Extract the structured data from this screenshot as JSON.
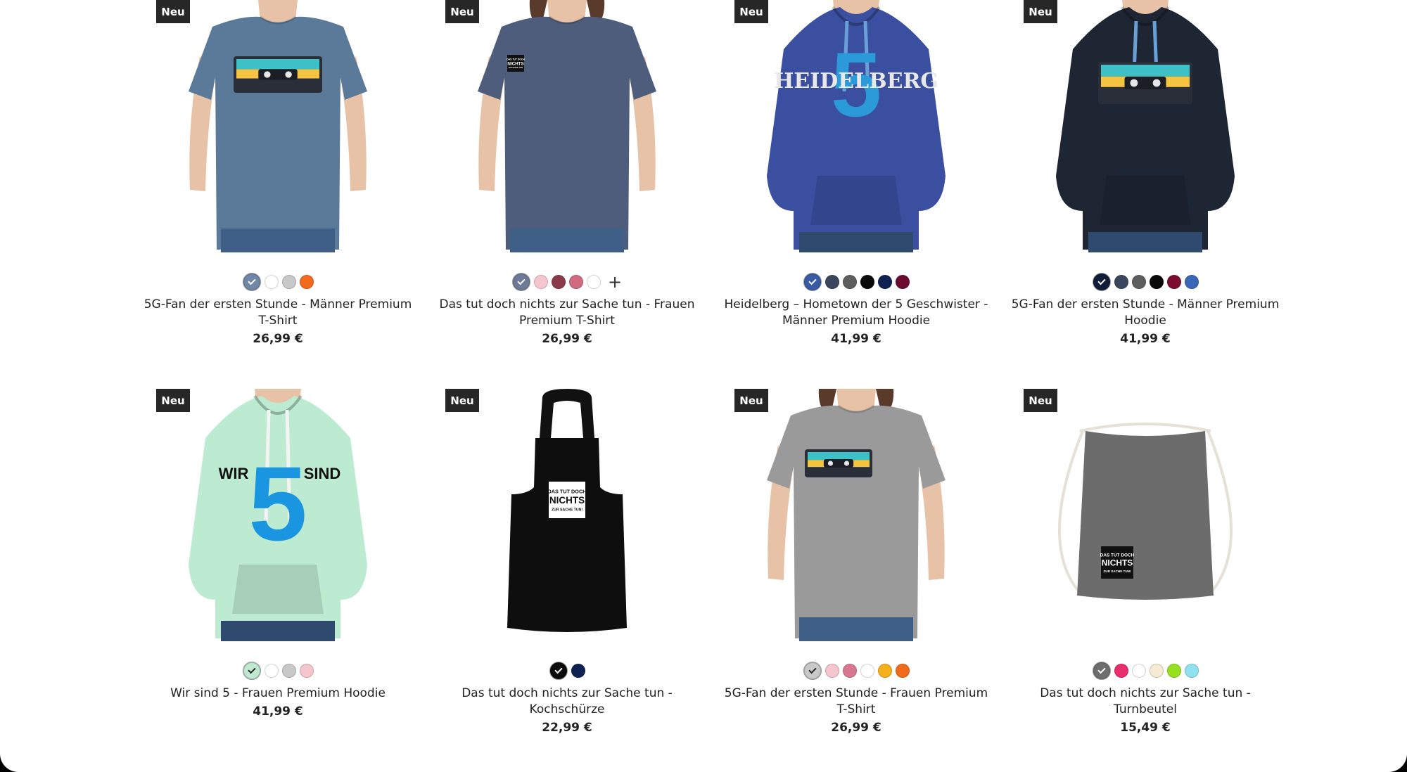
{
  "badge_label": "Neu",
  "products": [
    {
      "title": "5G-Fan der ersten Stunde - Männer Premium T-Shirt",
      "price": "26,99 €",
      "colors": [
        "#6f87a8",
        "#ffffff",
        "#c8c8c8",
        "#f26a1b"
      ],
      "selected": 0,
      "more": ""
    },
    {
      "title": "Das tut doch nichts zur Sache tun - Frauen Premium T-Shirt",
      "price": "26,99 €",
      "colors": [
        "#6f7a98",
        "#f6c6ce",
        "#8a3a48",
        "#d06a7e",
        "#ffffff"
      ],
      "selected": 0,
      "more": "+"
    },
    {
      "title": "Heidelberg – Hometown der 5 Geschwister - Männer Premium Hoodie",
      "price": "41,99 €",
      "colors": [
        "#3a5aa6",
        "#39465e",
        "#5e5e5e",
        "#0a0a0a",
        "#0e2150",
        "#6c0a2e"
      ],
      "selected": 0,
      "more": ""
    },
    {
      "title": "5G-Fan der ersten Stunde - Männer Premium Hoodie",
      "price": "41,99 €",
      "colors": [
        "#0f1d3a",
        "#39465e",
        "#5e5e5e",
        "#0a0a0a",
        "#7a0a30",
        "#3a66b8"
      ],
      "selected": 0,
      "more": ""
    },
    {
      "title": "Wir sind 5 - Frauen Premium Hoodie",
      "price": "41,99 €",
      "colors": [
        "#bfe9d1",
        "#ffffff",
        "#c8c8c8",
        "#f6c6ce"
      ],
      "selected": 0,
      "more": ""
    },
    {
      "title": "Das tut doch nichts zur Sache tun - Kochschürze",
      "price": "22,99 €",
      "colors": [
        "#0a0a0a",
        "#0e2150"
      ],
      "selected": 0,
      "more": ""
    },
    {
      "title": "5G-Fan der ersten Stunde - Frauen Premium T-Shirt",
      "price": "26,99 €",
      "colors": [
        "#c9c9c9",
        "#f6c6ce",
        "#d87890",
        "#ffffff",
        "#f5b01c",
        "#f26a1b"
      ],
      "selected": 0,
      "more": ""
    },
    {
      "title": "Das tut doch nichts zur Sache tun - Turnbeutel",
      "price": "15,49 €",
      "colors": [
        "#6e6e6e",
        "#ea2d6d",
        "#ffffff",
        "#f6ecd5",
        "#97e01f",
        "#8ee1ef"
      ],
      "selected": 0,
      "more": ""
    }
  ],
  "print_text": {
    "heidelberg": "HEIDELBERG",
    "five": "5",
    "wir": "WIR",
    "sind": "SIND",
    "slogan_top": "DAS TUT DOCH",
    "slogan_mid": "NICHTS",
    "slogan_bot": "ZUR SACHE TUN!"
  }
}
